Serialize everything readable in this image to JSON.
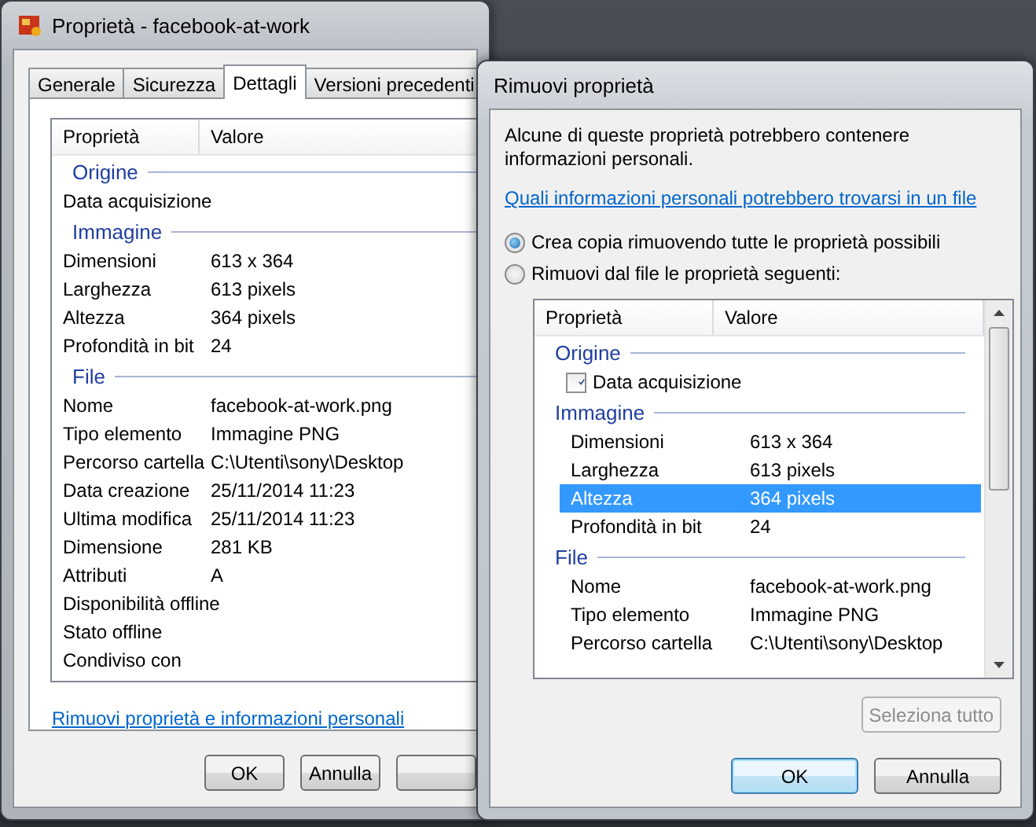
{
  "back_window": {
    "title": "Proprietà - facebook-at-work",
    "tabs": [
      {
        "label": "Generale",
        "selected": false
      },
      {
        "label": "Sicurezza",
        "selected": false
      },
      {
        "label": "Dettagli",
        "selected": true
      },
      {
        "label": "Versioni precedenti",
        "selected": false
      }
    ],
    "columns": [
      "Proprietà",
      "Valore"
    ],
    "groups": [
      {
        "name": "Origine",
        "rows": [
          {
            "property": "Data acquisizione",
            "value": ""
          }
        ]
      },
      {
        "name": "Immagine",
        "rows": [
          {
            "property": "Dimensioni",
            "value": "613 x 364"
          },
          {
            "property": "Larghezza",
            "value": "613 pixels"
          },
          {
            "property": "Altezza",
            "value": "364 pixels"
          },
          {
            "property": "Profondità in bit",
            "value": "24"
          }
        ]
      },
      {
        "name": "File",
        "rows": [
          {
            "property": "Nome",
            "value": "facebook-at-work.png"
          },
          {
            "property": "Tipo elemento",
            "value": "Immagine PNG"
          },
          {
            "property": "Percorso cartella",
            "value": "C:\\Utenti\\sony\\Desktop"
          },
          {
            "property": "Data creazione",
            "value": "25/11/2014 11:23"
          },
          {
            "property": "Ultima modifica",
            "value": "25/11/2014 11:23"
          },
          {
            "property": "Dimensione",
            "value": "281 KB"
          },
          {
            "property": "Attributi",
            "value": "A"
          },
          {
            "property": "Disponibilità offline",
            "value": ""
          },
          {
            "property": "Stato offline",
            "value": ""
          },
          {
            "property": "Condiviso con",
            "value": ""
          }
        ]
      }
    ],
    "link": "Rimuovi proprietà e informazioni personali",
    "buttons": [
      "OK",
      "Annulla"
    ]
  },
  "dialog": {
    "title": "Rimuovi proprietà",
    "message": "Alcune di queste proprietà potrebbero contenere informazioni personali.",
    "link": "Quali informazioni personali potrebbero trovarsi in un file",
    "options": [
      {
        "label": "Crea copia rimuovendo tutte le proprietà possibili",
        "selected": true
      },
      {
        "label": "Rimuovi dal file le proprietà seguenti:",
        "selected": false
      }
    ],
    "columns": [
      "Proprietà",
      "Valore"
    ],
    "groups": [
      {
        "name": "Origine",
        "rows": [
          {
            "kind": "check",
            "checked": true,
            "property": "Data acquisizione",
            "value": "",
            "selected": false
          }
        ]
      },
      {
        "name": "Immagine",
        "rows": [
          {
            "kind": "plain",
            "property": "Dimensioni",
            "value": "613 x 364",
            "selected": false
          },
          {
            "kind": "plain",
            "property": "Larghezza",
            "value": "613 pixels",
            "selected": false
          },
          {
            "kind": "plain",
            "property": "Altezza",
            "value": "364 pixels",
            "selected": true
          },
          {
            "kind": "plain",
            "property": "Profondità in bit",
            "value": "24",
            "selected": false
          }
        ]
      },
      {
        "name": "File",
        "rows": [
          {
            "kind": "plain",
            "property": "Nome",
            "value": "facebook-at-work.png",
            "selected": false
          },
          {
            "kind": "plain",
            "property": "Tipo elemento",
            "value": "Immagine PNG",
            "selected": false
          },
          {
            "kind": "plain",
            "property": "Percorso cartella",
            "value": "C:\\Utenti\\sony\\Desktop",
            "selected": false
          }
        ]
      }
    ],
    "select_all": {
      "label": "Seleziona tutto",
      "disabled": true
    },
    "buttons": [
      {
        "label": "OK",
        "default": true
      },
      {
        "label": "Annulla",
        "default": false
      }
    ]
  }
}
